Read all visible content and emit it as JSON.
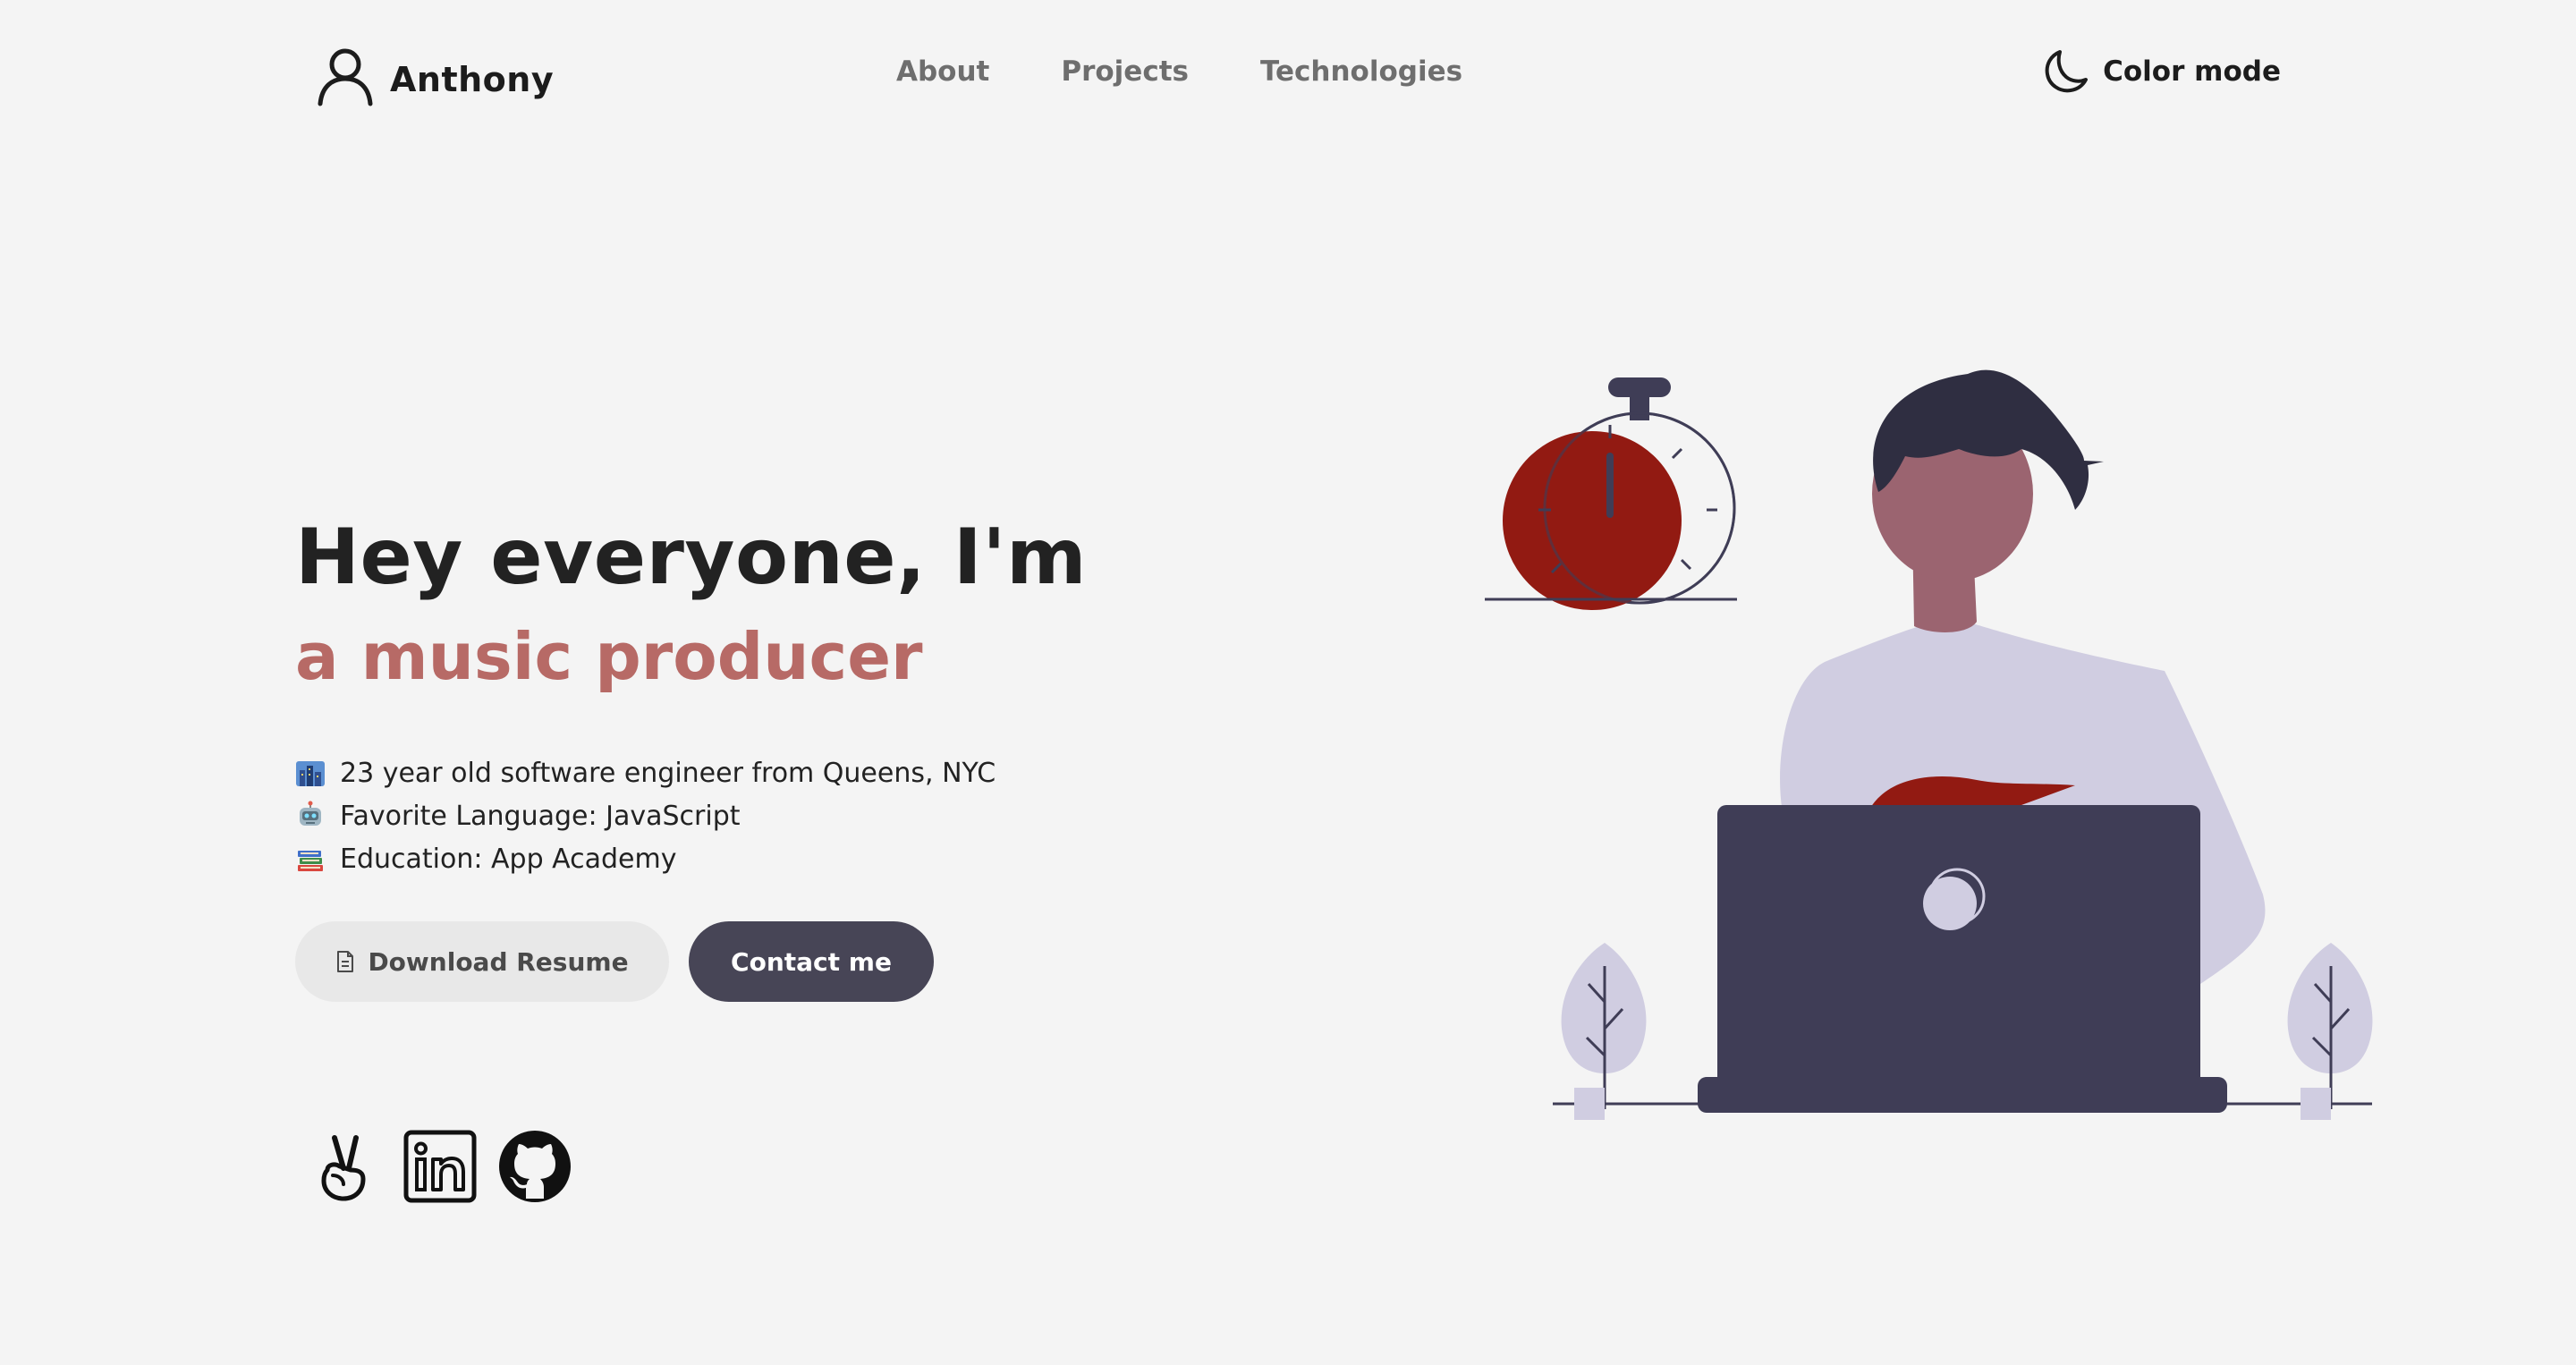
{
  "nav": {
    "brand_name": "Anthony",
    "links": [
      "About",
      "Projects",
      "Technologies"
    ],
    "color_mode_label": "Color mode"
  },
  "hero": {
    "title": "Hey everyone, I'm",
    "subtitle": "a music producer",
    "facts": [
      "23 year old software engineer from Queens, NYC",
      "Favorite Language: JavaScript",
      "Education: App Academy"
    ],
    "fact_icons": [
      "city-icon",
      "robot-icon",
      "books-icon"
    ],
    "download_label": "Download Resume",
    "contact_label": "Contact me"
  },
  "socials": [
    "angellist-icon",
    "linkedin-icon",
    "github-icon"
  ],
  "colors": {
    "background": "#f4f4f4",
    "accent_text": "#b76a66",
    "primary_button": "#474556",
    "secondary_button": "#e8e8e8",
    "illustration_red": "#921a12",
    "illustration_dark": "#3f3d56",
    "illustration_light": "#d0cde1"
  }
}
